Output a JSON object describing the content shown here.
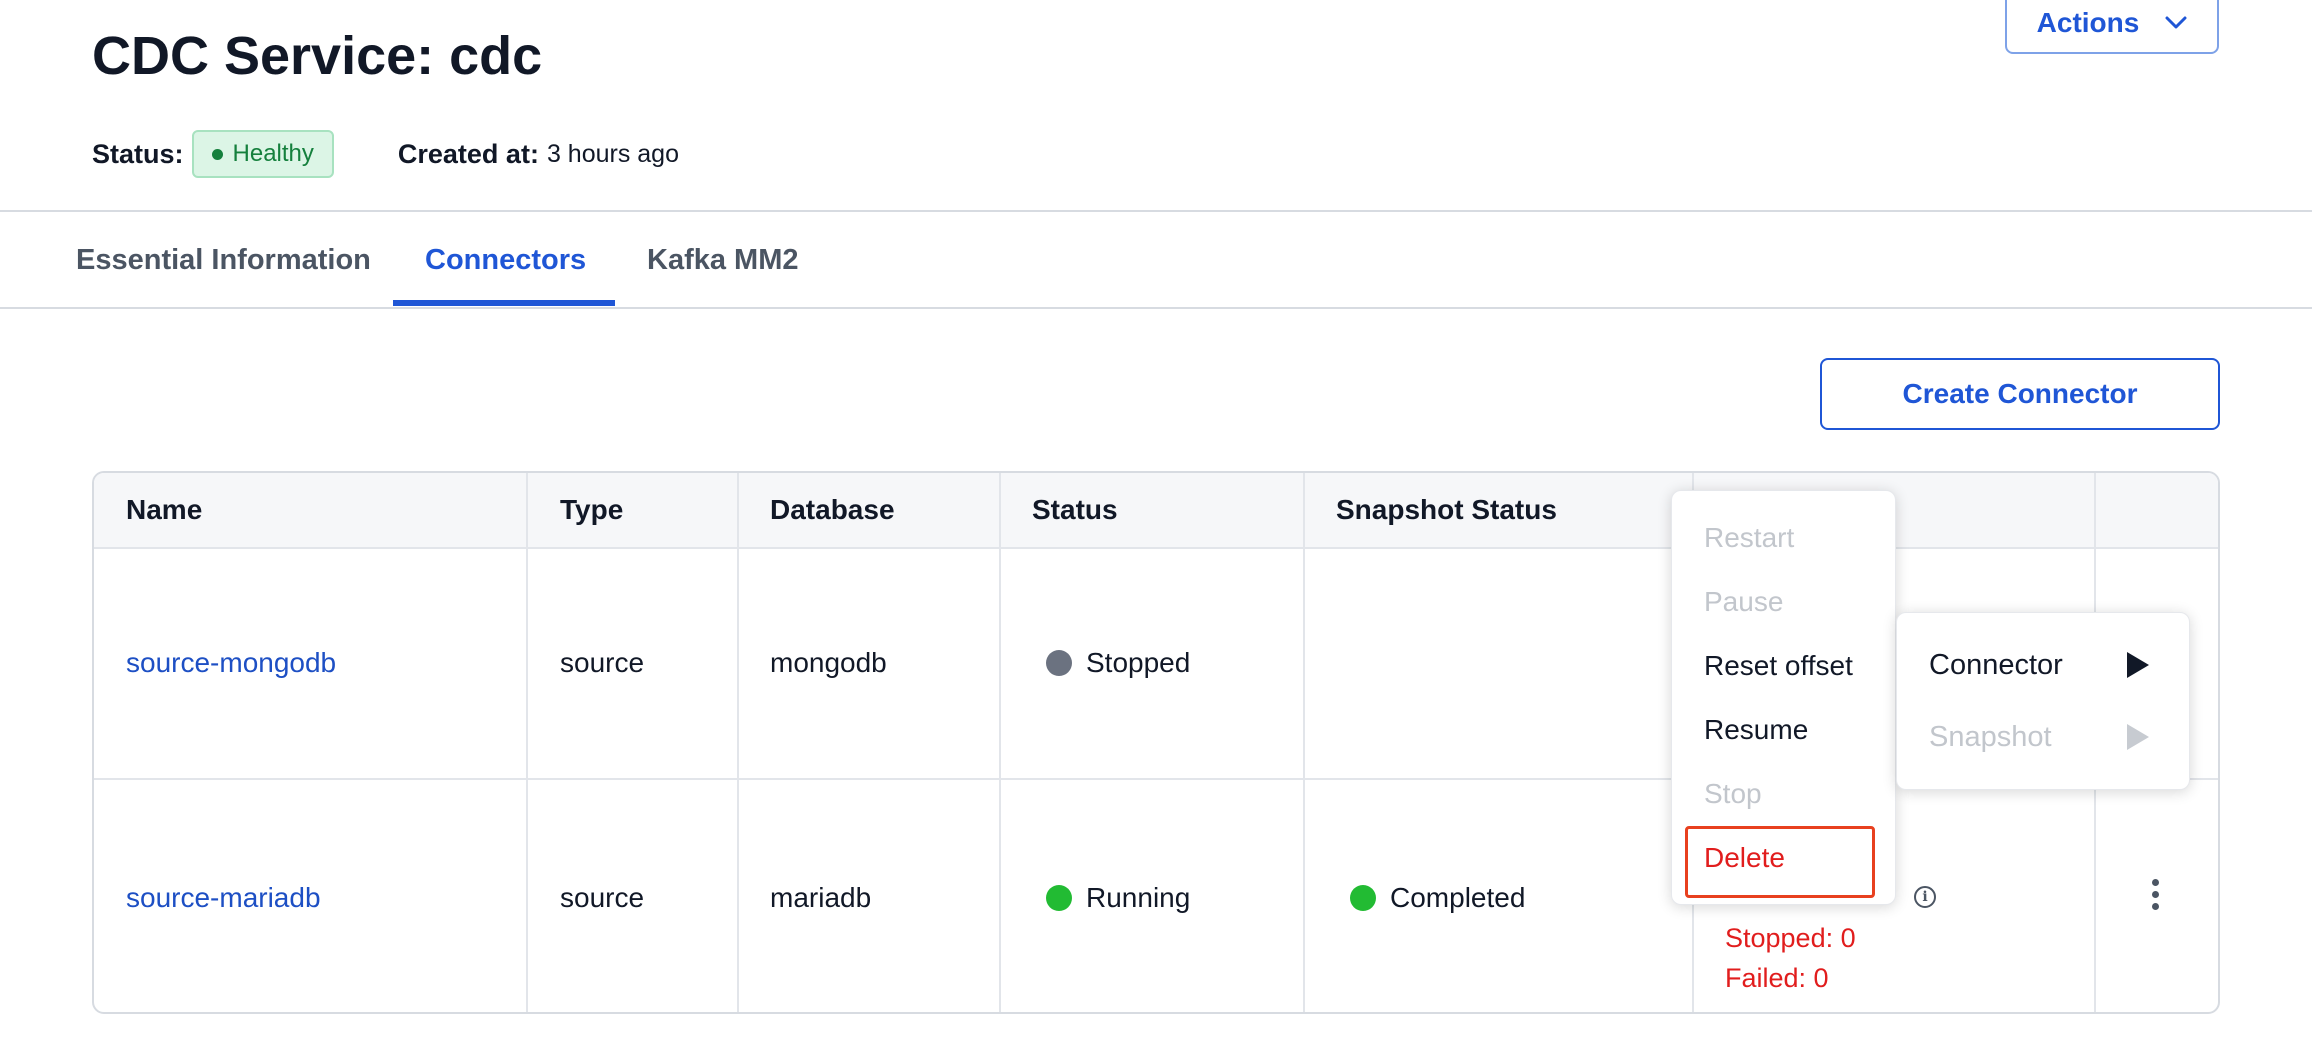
{
  "header": {
    "title": "CDC Service: cdc",
    "actions_label": "Actions",
    "status_label": "Status:",
    "status_value": "Healthy",
    "created_label": "Created at:",
    "created_value": "3 hours ago"
  },
  "tabs": [
    {
      "label": "Essential Information",
      "active": false
    },
    {
      "label": "Connectors",
      "active": true
    },
    {
      "label": "Kafka MM2",
      "active": false
    }
  ],
  "create_connector_label": "Create Connector",
  "table": {
    "columns": [
      "Name",
      "Type",
      "Database",
      "Status",
      "Snapshot Status",
      "",
      ""
    ],
    "rows": [
      {
        "name": "source-mongodb",
        "type": "source",
        "database": "mongodb",
        "status": "Stopped",
        "snapshot_status": ""
      },
      {
        "name": "source-mariadb",
        "type": "source",
        "database": "mariadb",
        "status": "Running",
        "snapshot_status": "Completed",
        "tasks_stopped": "Stopped: 0",
        "tasks_failed": "Failed: 0"
      }
    ]
  },
  "context_menu": {
    "items": [
      {
        "label": "Restart",
        "enabled": false
      },
      {
        "label": "Pause",
        "enabled": false
      },
      {
        "label": "Reset offset",
        "enabled": true
      },
      {
        "label": "Resume",
        "enabled": true
      },
      {
        "label": "Stop",
        "enabled": false
      },
      {
        "label": "Delete",
        "enabled": true,
        "danger": true
      }
    ]
  },
  "submenu": {
    "items": [
      {
        "label": "Connector",
        "enabled": true
      },
      {
        "label": "Snapshot",
        "enabled": false
      }
    ]
  },
  "colors": {
    "accent": "#1f56d6",
    "link": "#1d4fc4",
    "healthy_bg": "#dcf5e6",
    "healthy_text": "#15803d",
    "running": "#22bb33",
    "stopped": "#6b7280",
    "danger": "#e11d1d"
  }
}
